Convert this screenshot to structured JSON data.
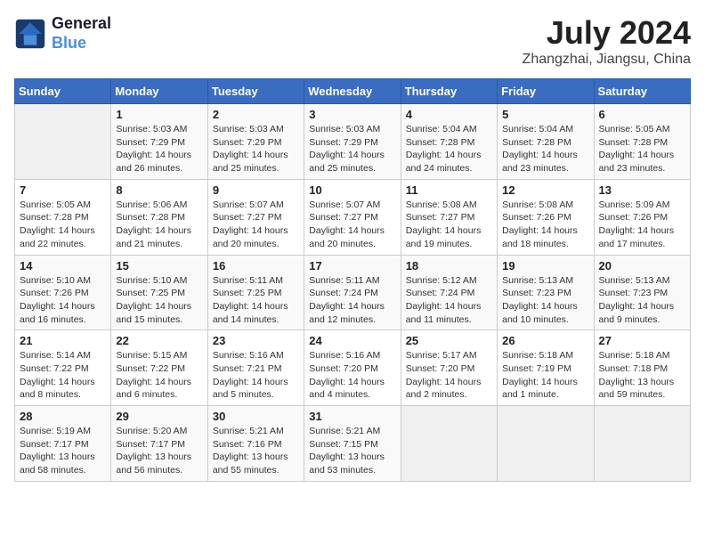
{
  "header": {
    "logo_line1": "General",
    "logo_line2": "Blue",
    "month_year": "July 2024",
    "location": "Zhangzhai, Jiangsu, China"
  },
  "calendar": {
    "headers": [
      "Sunday",
      "Monday",
      "Tuesday",
      "Wednesday",
      "Thursday",
      "Friday",
      "Saturday"
    ],
    "weeks": [
      [
        {
          "day": "",
          "info": ""
        },
        {
          "day": "1",
          "info": "Sunrise: 5:03 AM\nSunset: 7:29 PM\nDaylight: 14 hours\nand 26 minutes."
        },
        {
          "day": "2",
          "info": "Sunrise: 5:03 AM\nSunset: 7:29 PM\nDaylight: 14 hours\nand 25 minutes."
        },
        {
          "day": "3",
          "info": "Sunrise: 5:03 AM\nSunset: 7:29 PM\nDaylight: 14 hours\nand 25 minutes."
        },
        {
          "day": "4",
          "info": "Sunrise: 5:04 AM\nSunset: 7:28 PM\nDaylight: 14 hours\nand 24 minutes."
        },
        {
          "day": "5",
          "info": "Sunrise: 5:04 AM\nSunset: 7:28 PM\nDaylight: 14 hours\nand 23 minutes."
        },
        {
          "day": "6",
          "info": "Sunrise: 5:05 AM\nSunset: 7:28 PM\nDaylight: 14 hours\nand 23 minutes."
        }
      ],
      [
        {
          "day": "7",
          "info": "Sunrise: 5:05 AM\nSunset: 7:28 PM\nDaylight: 14 hours\nand 22 minutes."
        },
        {
          "day": "8",
          "info": "Sunrise: 5:06 AM\nSunset: 7:28 PM\nDaylight: 14 hours\nand 21 minutes."
        },
        {
          "day": "9",
          "info": "Sunrise: 5:07 AM\nSunset: 7:27 PM\nDaylight: 14 hours\nand 20 minutes."
        },
        {
          "day": "10",
          "info": "Sunrise: 5:07 AM\nSunset: 7:27 PM\nDaylight: 14 hours\nand 20 minutes."
        },
        {
          "day": "11",
          "info": "Sunrise: 5:08 AM\nSunset: 7:27 PM\nDaylight: 14 hours\nand 19 minutes."
        },
        {
          "day": "12",
          "info": "Sunrise: 5:08 AM\nSunset: 7:26 PM\nDaylight: 14 hours\nand 18 minutes."
        },
        {
          "day": "13",
          "info": "Sunrise: 5:09 AM\nSunset: 7:26 PM\nDaylight: 14 hours\nand 17 minutes."
        }
      ],
      [
        {
          "day": "14",
          "info": "Sunrise: 5:10 AM\nSunset: 7:26 PM\nDaylight: 14 hours\nand 16 minutes."
        },
        {
          "day": "15",
          "info": "Sunrise: 5:10 AM\nSunset: 7:25 PM\nDaylight: 14 hours\nand 15 minutes."
        },
        {
          "day": "16",
          "info": "Sunrise: 5:11 AM\nSunset: 7:25 PM\nDaylight: 14 hours\nand 14 minutes."
        },
        {
          "day": "17",
          "info": "Sunrise: 5:11 AM\nSunset: 7:24 PM\nDaylight: 14 hours\nand 12 minutes."
        },
        {
          "day": "18",
          "info": "Sunrise: 5:12 AM\nSunset: 7:24 PM\nDaylight: 14 hours\nand 11 minutes."
        },
        {
          "day": "19",
          "info": "Sunrise: 5:13 AM\nSunset: 7:23 PM\nDaylight: 14 hours\nand 10 minutes."
        },
        {
          "day": "20",
          "info": "Sunrise: 5:13 AM\nSunset: 7:23 PM\nDaylight: 14 hours\nand 9 minutes."
        }
      ],
      [
        {
          "day": "21",
          "info": "Sunrise: 5:14 AM\nSunset: 7:22 PM\nDaylight: 14 hours\nand 8 minutes."
        },
        {
          "day": "22",
          "info": "Sunrise: 5:15 AM\nSunset: 7:22 PM\nDaylight: 14 hours\nand 6 minutes."
        },
        {
          "day": "23",
          "info": "Sunrise: 5:16 AM\nSunset: 7:21 PM\nDaylight: 14 hours\nand 5 minutes."
        },
        {
          "day": "24",
          "info": "Sunrise: 5:16 AM\nSunset: 7:20 PM\nDaylight: 14 hours\nand 4 minutes."
        },
        {
          "day": "25",
          "info": "Sunrise: 5:17 AM\nSunset: 7:20 PM\nDaylight: 14 hours\nand 2 minutes."
        },
        {
          "day": "26",
          "info": "Sunrise: 5:18 AM\nSunset: 7:19 PM\nDaylight: 14 hours\nand 1 minute."
        },
        {
          "day": "27",
          "info": "Sunrise: 5:18 AM\nSunset: 7:18 PM\nDaylight: 13 hours\nand 59 minutes."
        }
      ],
      [
        {
          "day": "28",
          "info": "Sunrise: 5:19 AM\nSunset: 7:17 PM\nDaylight: 13 hours\nand 58 minutes."
        },
        {
          "day": "29",
          "info": "Sunrise: 5:20 AM\nSunset: 7:17 PM\nDaylight: 13 hours\nand 56 minutes."
        },
        {
          "day": "30",
          "info": "Sunrise: 5:21 AM\nSunset: 7:16 PM\nDaylight: 13 hours\nand 55 minutes."
        },
        {
          "day": "31",
          "info": "Sunrise: 5:21 AM\nSunset: 7:15 PM\nDaylight: 13 hours\nand 53 minutes."
        },
        {
          "day": "",
          "info": ""
        },
        {
          "day": "",
          "info": ""
        },
        {
          "day": "",
          "info": ""
        }
      ]
    ]
  }
}
